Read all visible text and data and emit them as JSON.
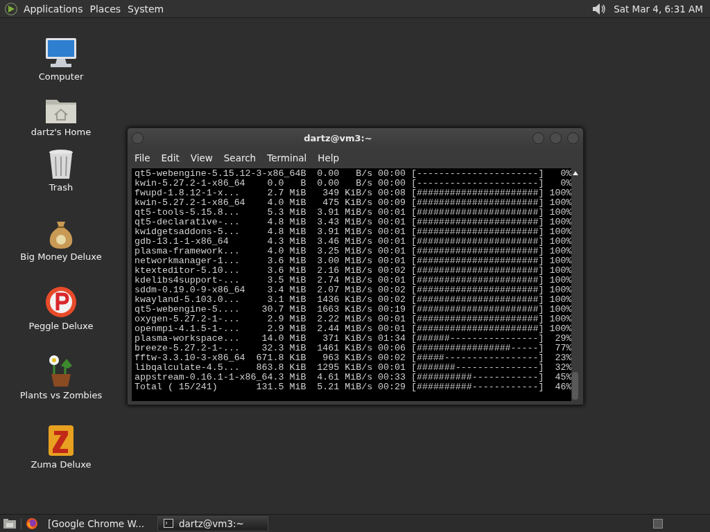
{
  "top_panel": {
    "menus": [
      "Applications",
      "Places",
      "System"
    ],
    "clock": "Sat Mar  4,  6:31 AM"
  },
  "desktop_icons": [
    {
      "kind": "computer",
      "label": "Computer"
    },
    {
      "kind": "home",
      "label": "dartz's Home"
    },
    {
      "kind": "trash",
      "label": "Trash"
    },
    {
      "kind": "money",
      "label": "Big Money Deluxe"
    },
    {
      "kind": "peggle",
      "label": "Peggle Deluxe"
    },
    {
      "kind": "plants",
      "label": "Plants vs Zombies"
    },
    {
      "kind": "zuma",
      "label": "Zuma Deluxe"
    }
  ],
  "terminal": {
    "title": "dartz@vm3:~",
    "menu": [
      "File",
      "Edit",
      "View",
      "Search",
      "Terminal",
      "Help"
    ],
    "lines": [
      "qt5-webengine-5.15.12-3-x86_64B  0.00   B/s 00:00 [----------------------]   0%",
      "kwin-5.27.2-1-x86_64    0.0   B  0.00   B/s 00:00 [----------------------]   0%",
      "fwupd-1.8.12-1-x...     2.7 MiB   349 KiB/s 00:08 [######################] 100%",
      "kwin-5.27.2-1-x86_64    4.0 MiB   475 KiB/s 00:09 [######################] 100%",
      "qt5-tools-5.15.8...     5.3 MiB  3.91 MiB/s 00:01 [######################] 100%",
      "qt5-declarative-...     4.8 MiB  3.43 MiB/s 00:01 [######################] 100%",
      "kwidgetsaddons-5...     4.8 MiB  3.91 MiB/s 00:01 [######################] 100%",
      "gdb-13.1-1-x86_64       4.3 MiB  3.46 MiB/s 00:01 [######################] 100%",
      "plasma-framework...     4.0 MiB  3.25 MiB/s 00:01 [######################] 100%",
      "networkmanager-1...     3.6 MiB  3.00 MiB/s 00:01 [######################] 100%",
      "ktexteditor-5.10...     3.6 MiB  2.16 MiB/s 00:02 [######################] 100%",
      "kdelibs4support-...     3.5 MiB  2.74 MiB/s 00:01 [######################] 100%",
      "sddm-0.19.0-9-x86_64    3.4 MiB  2.07 MiB/s 00:02 [######################] 100%",
      "kwayland-5.103.0...     3.1 MiB  1436 KiB/s 00:02 [######################] 100%",
      "qt5-webengine-5....    30.7 MiB  1663 KiB/s 00:19 [######################] 100%",
      "oxygen-5.27.2-1-...     2.9 MiB  2.22 MiB/s 00:01 [######################] 100%",
      "openmpi-4.1.5-1-...     2.9 MiB  2.44 MiB/s 00:01 [######################] 100%",
      "plasma-workspace...    14.0 MiB   371 KiB/s 01:34 [######----------------]  29%",
      "breeze-5.27.2-1-...    32.3 MiB  1461 KiB/s 00:06 [#################-----]  77%",
      "fftw-3.3.10-3-x86_64  671.8 KiB   963 KiB/s 00:02 [#####-----------------]  23%",
      "libqalculate-4.5...   863.8 KiB  1295 KiB/s 00:01 [#######---------------]  32%",
      "appstream-0.16.1-1-x86_64.3 MiB  4.61 MiB/s 00:33 [##########------------]  45%",
      "Total ( 15/241)       131.5 MiB  5.21 MiB/s 00:29 [##########------------]  46%"
    ]
  },
  "taskbar": {
    "windows": [
      {
        "kind": "browser",
        "label": "[Google Chrome W...",
        "selected": false
      },
      {
        "kind": "terminal",
        "label": "dartz@vm3:~",
        "selected": true
      }
    ]
  }
}
